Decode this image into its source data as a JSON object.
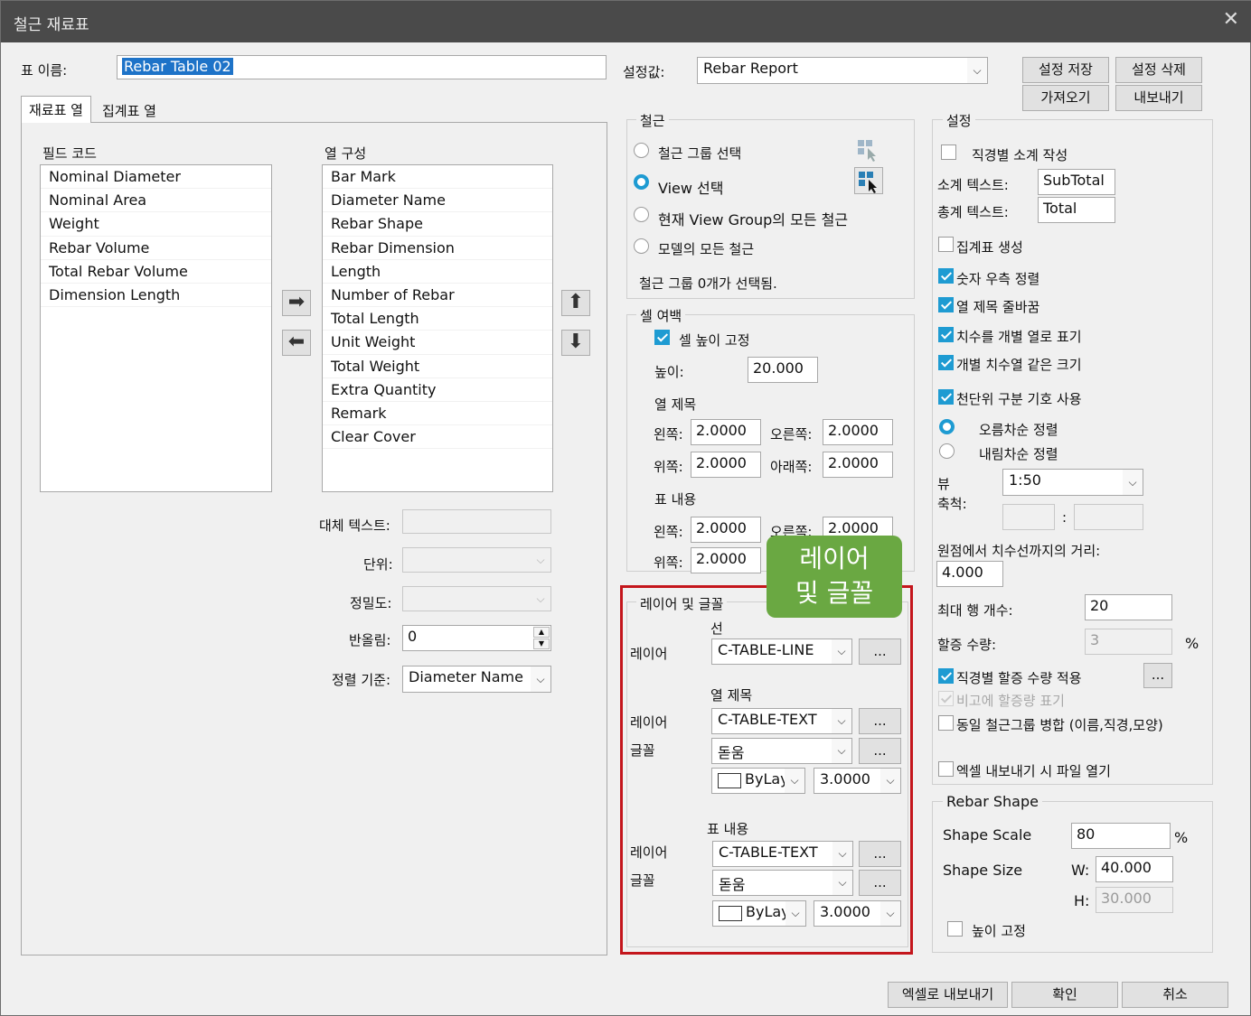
{
  "window": {
    "title": "철근 재료표",
    "close_glyph": "✕"
  },
  "table_name": {
    "label": "표 이름:",
    "value": "Rebar Table 02"
  },
  "preset": {
    "label": "설정값:",
    "value": "Rebar Report"
  },
  "buttons": {
    "save_settings": "설정 저장",
    "delete_settings": "설정 삭제",
    "import": "가져오기",
    "export": "내보내기",
    "export_excel": "엑셀로 내보내기",
    "ok": "확인",
    "cancel": "취소"
  },
  "tabs": [
    {
      "label": "재료표 열"
    },
    {
      "label": "집계표 열"
    }
  ],
  "field_code": {
    "label": "필드 코드",
    "items": [
      "Nominal Diameter",
      "Nominal Area",
      "Weight",
      "Rebar Volume",
      "Total Rebar Volume",
      "Dimension Length"
    ]
  },
  "column_config": {
    "label": "열 구성",
    "items": [
      "Bar Mark",
      "Diameter Name",
      "Rebar Shape",
      "Rebar Dimension",
      "Length",
      "Number of Rebar",
      "Total Length",
      "Unit Weight",
      "Total Weight",
      "Extra Quantity",
      "Remark",
      "Clear Cover"
    ]
  },
  "column_props": {
    "alt_text_label": "대체 텍스트:",
    "alt_text_value": "",
    "unit_label": "단위:",
    "precision_label": "정밀도:",
    "rounding_label": "반올림:",
    "rounding_value": "0",
    "sort_label": "정렬 기준:",
    "sort_value": "Diameter Name"
  },
  "rebar": {
    "title": "철근",
    "opt_group": "철근 그룹 선택",
    "opt_view": "View 선택",
    "opt_view_group": "현재 View Group의 모든 철근",
    "opt_model": "모델의 모든 철근",
    "status": "철근 그룹 0개가 선택됨."
  },
  "cell_margin": {
    "title": "셀 여백",
    "fix_height": "셀 높이 고정",
    "height_label": "높이:",
    "height_value": "20.000",
    "col_title": "열 제목",
    "left_label": "왼쪽:",
    "right_label": "오른쪽:",
    "top_label": "위쪽:",
    "bottom_label": "아래쪽:",
    "col_left": "2.0000",
    "col_right": "2.0000",
    "col_top": "2.0000",
    "col_bottom": "2.0000",
    "content_title": "표 내용",
    "ct_left": "2.0000",
    "ct_right": "2.0000",
    "ct_top": "2.0000"
  },
  "callout": {
    "line1": "레이어",
    "line2": "및 글꼴",
    "color": "#6aa842"
  },
  "layer_font": {
    "title": "레이어 및 글꼴",
    "line_title": "선",
    "layer_label": "레이어",
    "font_label": "글꼴",
    "line_layer": "C-TABLE-LINE",
    "col_title": "열 제목",
    "col_layer": "C-TABLE-TEXT",
    "col_font": "돋움",
    "col_color": "ByLayer",
    "col_size": "3.0000",
    "content_title": "표 내용",
    "ct_layer": "C-TABLE-TEXT",
    "ct_font": "돋움",
    "ct_color": "ByLayer",
    "ct_size": "3.0000",
    "more": "..."
  },
  "settings": {
    "title": "설정",
    "subtotal_by_dia": "직경별 소계 작성",
    "subtotal_text_label": "소계 텍스트:",
    "subtotal_text": "SubTotal",
    "total_text_label": "총계 텍스트:",
    "total_text": "Total",
    "create_summary": "집계표 생성",
    "align_right": "숫자 우측 정렬",
    "wrap_titles": "열 제목 줄바꿈",
    "dims_separate": "치수를 개별 열로 표기",
    "same_width": "개별 치수열 같은 크기",
    "thousand_sep": "천단위 구분 기호 사용",
    "asc": "오름차순 정렬",
    "desc": "내림차순 정렬",
    "view_scale_label_1": "뷰",
    "view_scale_label_2": "축척:",
    "view_scale": "1:50",
    "ratio_sep": ":",
    "dist_label": "원점에서 치수선까지의 거리:",
    "dist_value": "4.000",
    "max_rows_label": "최대 행 개수:",
    "max_rows": "20",
    "extra_label": "할증 수량:",
    "extra_value": "3",
    "percent": "%",
    "apply_extra": "직경별 할증 수량 적용",
    "note_extra": "비고에 할증량 표기",
    "merge_same": "동일 철근그룹 병합 (이름,직경,모양)",
    "open_excel": "엑셀 내보내기 시 파일 열기",
    "more": "..."
  },
  "rebar_shape": {
    "title": "Rebar Shape",
    "scale_label": "Shape Scale",
    "scale_value": "80",
    "percent": "%",
    "size_label": "Shape Size",
    "w_label": "W:",
    "w_value": "40.000",
    "h_label": "H:",
    "h_value": "30.000",
    "fix_height": "높이 고정"
  },
  "icons": {
    "arrow_right": "➡",
    "arrow_left": "⬅",
    "arrow_up": "⬆",
    "arrow_down": "⬇",
    "dropdown": "⌵"
  },
  "colors": {
    "accent": "#1e9bd2",
    "highlight_box": "#c4161c",
    "selection": "#1e73c8"
  }
}
